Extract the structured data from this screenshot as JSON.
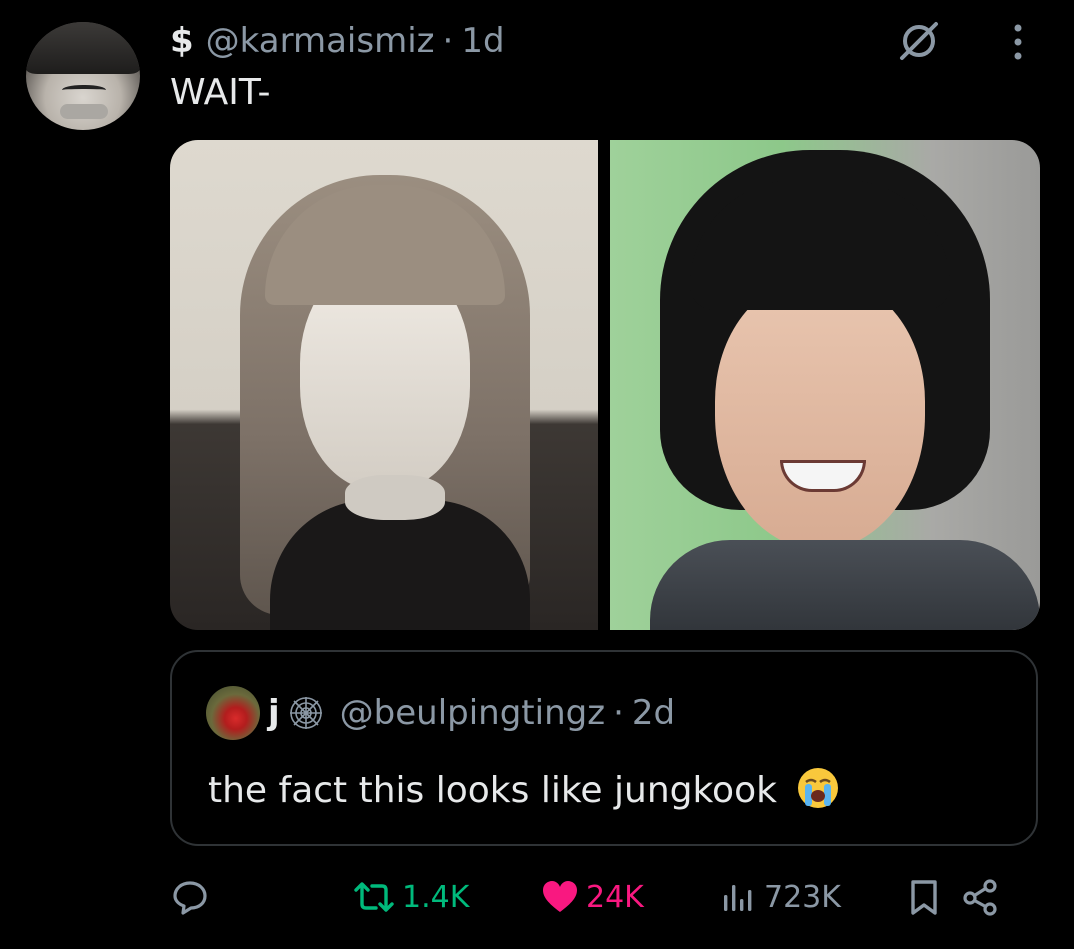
{
  "tweet": {
    "display_name": "$",
    "handle": "@karmaismiz",
    "separator": "·",
    "time": "1d",
    "text": "WAIT-"
  },
  "quoted_tweet": {
    "display_name": "j",
    "handle": "@beulpingtingz",
    "separator": "·",
    "time": "2d",
    "text": "the fact this looks like jungkook"
  },
  "actions": {
    "retweets": "1.4K",
    "likes": "24K",
    "views": "723K"
  },
  "colors": {
    "background": "#000000",
    "text": "#e7e9ea",
    "muted": "#8b98a5",
    "retweet": "#00ba7c",
    "like": "#f91880",
    "border": "#2f3336"
  },
  "icons": [
    "grok-icon",
    "more-icon",
    "reply-icon",
    "retweet-icon",
    "heart-icon",
    "views-icon",
    "bookmark-icon",
    "share-icon",
    "spiderweb-icon",
    "crying-face-icon"
  ]
}
